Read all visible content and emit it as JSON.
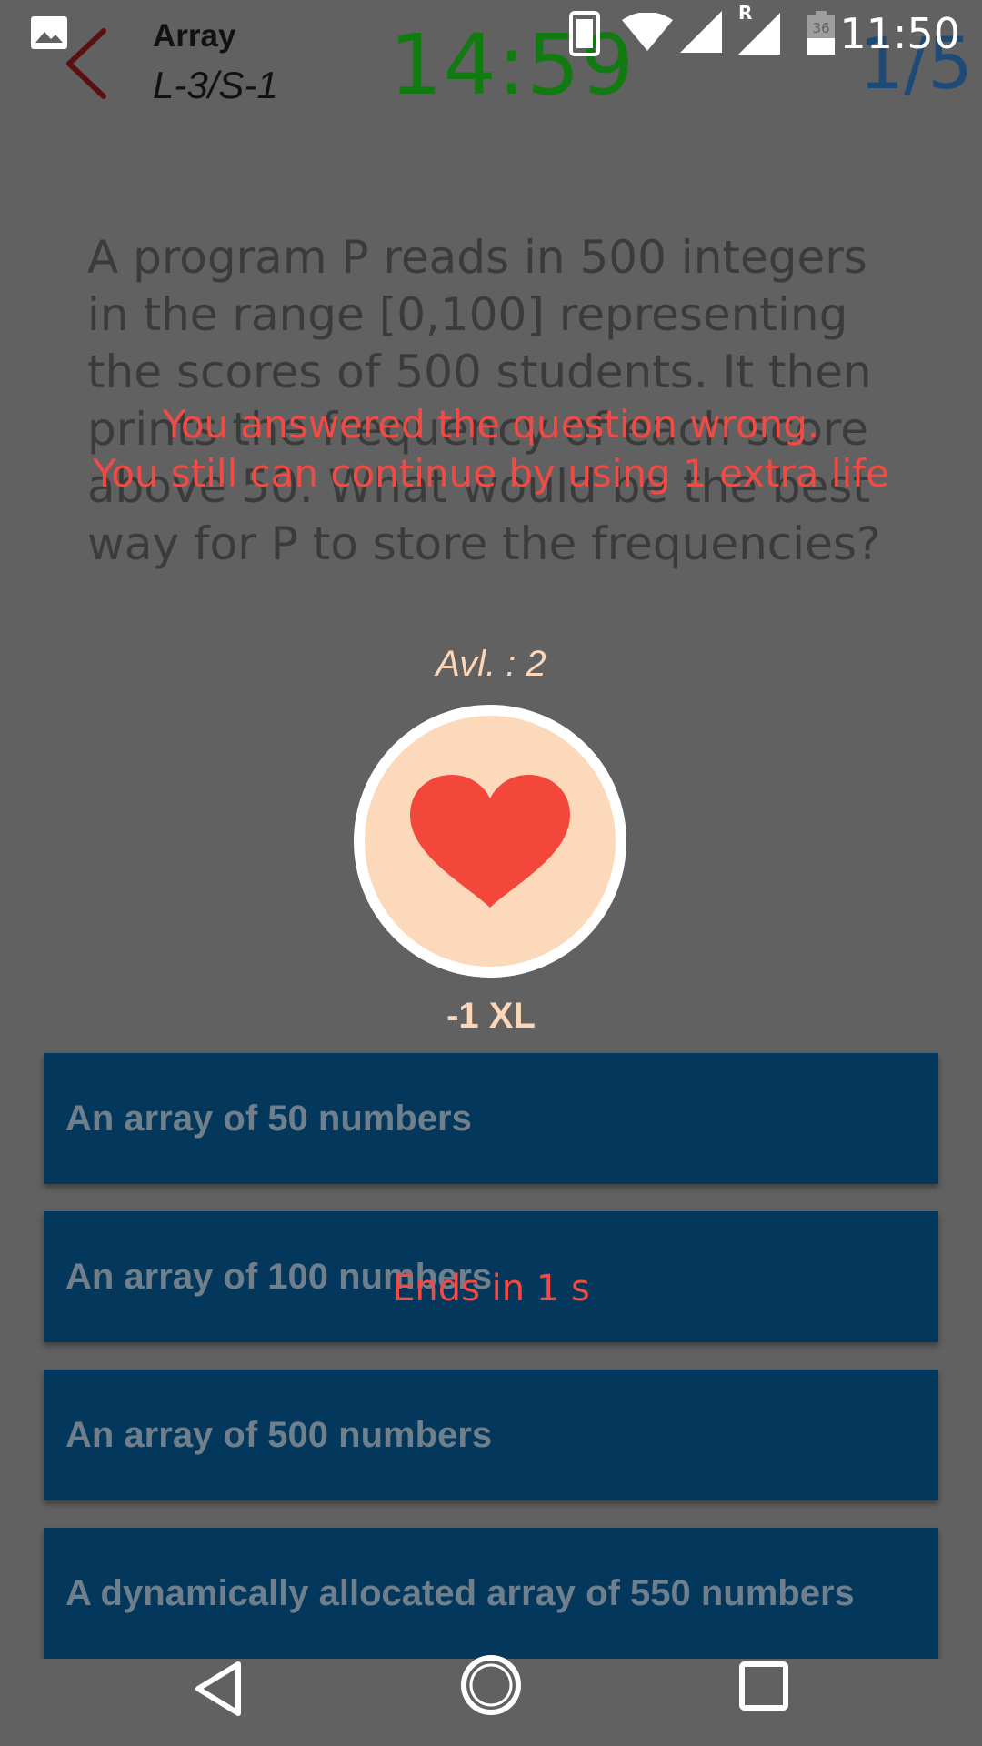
{
  "status_bar": {
    "time": "11:50",
    "battery_level": "36",
    "roaming_label": "R",
    "icons": [
      "gallery-icon",
      "vibrate-icon",
      "wifi-icon",
      "signal-icon",
      "signal-roaming-icon",
      "battery-icon"
    ]
  },
  "header": {
    "topic": "Array",
    "subtitle": "L-3/S-1",
    "timer": "14:59",
    "progress": "1/5"
  },
  "question": {
    "text": "A program P reads in 500 integers in the range [0,100] representing the scores of 500 students. It then prints the frequency of each score above 50. What would be the best way for P to store the frequencies?"
  },
  "feedback": {
    "line1": "You answered the question wrong.",
    "line2": "You still can continue by using 1 extra life"
  },
  "life_dialog": {
    "available": "Avl. : 2",
    "cost": "-1 XL",
    "countdown": "Ends in 1 s"
  },
  "options": [
    {
      "label": "An array of 50 numbers"
    },
    {
      "label": "An array of 100 numbers"
    },
    {
      "label": "An array of 500 numbers"
    },
    {
      "label": "A dynamically allocated array of 550 numbers"
    }
  ],
  "colors": {
    "overlay_bg": "#616161",
    "timer": "#117a11",
    "progress": "#1d4a78",
    "option_bg": "#03375c",
    "warning_text": "#f24a44",
    "heart": "#f4473b",
    "heart_circle": "#fcd9bb"
  }
}
